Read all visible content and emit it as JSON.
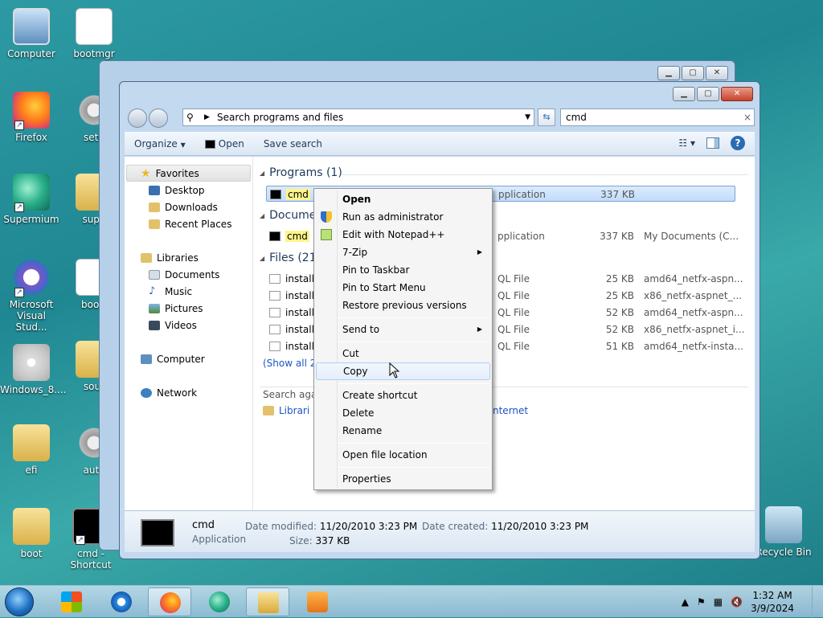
{
  "desktop": {
    "icons": [
      {
        "label": "Computer"
      },
      {
        "label": "bootmgr"
      },
      {
        "label": "Firefox"
      },
      {
        "label": "setu"
      },
      {
        "label": "Supermium"
      },
      {
        "label": "supp"
      },
      {
        "label": "Microsoft Visual Stud..."
      },
      {
        "label": "bootr"
      },
      {
        "label": "Windows_8...."
      },
      {
        "label": "sour"
      },
      {
        "label": "efi"
      },
      {
        "label": "auto"
      },
      {
        "label": "boot"
      },
      {
        "label": "cmd - Shortcut"
      },
      {
        "label": "Recycle Bin"
      }
    ]
  },
  "explorer": {
    "address": {
      "text": "Search programs and files"
    },
    "search": {
      "value": "cmd",
      "clear": "×"
    },
    "toolbar": {
      "organize": "Organize",
      "open": "Open",
      "save_search": "Save search"
    },
    "sidebar": {
      "favorites": "Favorites",
      "desktop": "Desktop",
      "downloads": "Downloads",
      "recent": "Recent Places",
      "libraries": "Libraries",
      "documents": "Documents",
      "music": "Music",
      "pictures": "Pictures",
      "videos": "Videos",
      "computer": "Computer",
      "network": "Network"
    },
    "groups": {
      "programs": "Programs (1)",
      "documents": "Docume",
      "files": "Files (21"
    },
    "programs_row": {
      "name": "cmd",
      "type": "pplication",
      "size": "337 KB"
    },
    "documents_row": {
      "name": "cmd",
      "type": "pplication",
      "size": "337 KB",
      "location": "My Documents (C..."
    },
    "files_rows": [
      {
        "name": "installc",
        "type": "QL File",
        "size": "25 KB",
        "location": "amd64_netfx-aspn..."
      },
      {
        "name": "installc",
        "type": "QL File",
        "size": "25 KB",
        "location": "x86_netfx-aspnet_..."
      },
      {
        "name": "installp",
        "type": "QL File",
        "size": "52 KB",
        "location": "amd64_netfx-aspn..."
      },
      {
        "name": "installp",
        "type": "QL File",
        "size": "52 KB",
        "location": "x86_netfx-aspnet_i..."
      },
      {
        "name": "installs",
        "type": "QL File",
        "size": "51 KB",
        "location": "amd64_netfx-insta..."
      }
    ],
    "show_all": "(Show all 2",
    "search_again": "Search aga",
    "search_again_libraries": "Librari",
    "search_again_internet": "nternet",
    "details": {
      "name": "cmd",
      "type": "Application",
      "modified_label": "Date modified:",
      "modified_value": "11/20/2010 3:23 PM",
      "created_label": "Date created:",
      "created_value": "11/20/2010 3:23 PM",
      "size_label": "Size:",
      "size_value": "337 KB"
    }
  },
  "context_menu": {
    "items": [
      {
        "label": "Open"
      },
      {
        "label": "Run as administrator"
      },
      {
        "label": "Edit with Notepad++"
      },
      {
        "label": "7-Zip"
      },
      {
        "label": "Pin to Taskbar"
      },
      {
        "label": "Pin to Start Menu"
      },
      {
        "label": "Restore previous versions"
      },
      {
        "label": "Send to"
      },
      {
        "label": "Cut"
      },
      {
        "label": "Copy"
      },
      {
        "label": "Create shortcut"
      },
      {
        "label": "Delete"
      },
      {
        "label": "Rename"
      },
      {
        "label": "Open file location"
      },
      {
        "label": "Properties"
      }
    ]
  },
  "taskbar": {
    "time": "1:32 AM",
    "date": "3/9/2024"
  }
}
